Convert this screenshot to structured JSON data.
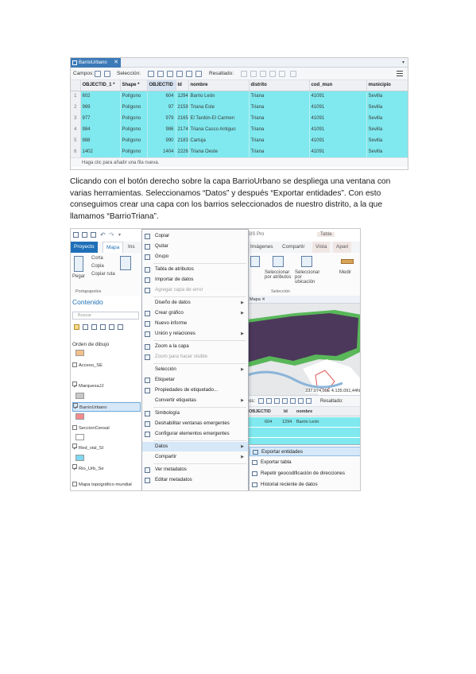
{
  "attribute_table": {
    "tab_title": "BarrioUrbano",
    "toolbar": {
      "fields_label": "Campos:",
      "selection_label": "Selección:",
      "highlight_label": "Resaltado:"
    },
    "columns": [
      "",
      "OBJECTID_1 *",
      "Shape *",
      "OBJECTID",
      "Id",
      "nombre",
      "distrito",
      "cod_mun",
      "municipio"
    ],
    "rows": [
      {
        "n": "1",
        "objectid_1": "602",
        "shape": "Polígono",
        "objectid": "604",
        "id": "1294",
        "nombre": "Barrio León",
        "distrito": "Triana",
        "cod_mun": "41091",
        "municipio": "Sevilla"
      },
      {
        "n": "2",
        "objectid_1": "969",
        "shape": "Polígono",
        "objectid": "97",
        "id": "2159",
        "nombre": "Triana Este",
        "distrito": "Triana",
        "cod_mun": "41091",
        "municipio": "Sevilla"
      },
      {
        "n": "3",
        "objectid_1": "977",
        "shape": "Polígono",
        "objectid": "979",
        "id": "2165",
        "nombre": "El Tardón-El Carmen",
        "distrito": "Triana",
        "cod_mun": "41091",
        "municipio": "Sevilla"
      },
      {
        "n": "4",
        "objectid_1": "984",
        "shape": "Polígono",
        "objectid": "986",
        "id": "2174",
        "nombre": "Triana Casco Antiguo",
        "distrito": "Triana",
        "cod_mun": "41091",
        "municipio": "Sevilla"
      },
      {
        "n": "5",
        "objectid_1": "988",
        "shape": "Polígono",
        "objectid": "990",
        "id": "2183",
        "nombre": "Cartuja",
        "distrito": "Triana",
        "cod_mun": "41091",
        "municipio": "Sevilla"
      },
      {
        "n": "6",
        "objectid_1": "1402",
        "shape": "Polígono",
        "objectid": "1404",
        "id": "2226",
        "nombre": "Triana Oeste",
        "distrito": "Triana",
        "cod_mun": "41091",
        "municipio": "Sevilla"
      }
    ],
    "status": "Haga clic para añadir una fila nueva."
  },
  "paragraph": "Clicando con el botón derecho sobre la capa BarrioUrbano se despliega una ventana con varias herramientas. Seleccionamos “Datos” y después “Exportar entidades”. Con esto conseguimos crear una capa con los barrios seleccionados de nuestro distrito, a la que llamamos “BarrioTriana”.",
  "gis": {
    "ribbon_tabs": [
      "Proyecto",
      "Mapa",
      "Ins"
    ],
    "ribbon_tabs_right": [
      "GIS Pro",
      "Tabla"
    ],
    "ribbon_subtabs": [
      "Imágenes",
      "Compartir",
      "Vista",
      "Apari"
    ],
    "clipboard": {
      "paste": "Pegar",
      "cut": "Corta",
      "copy": "Copia",
      "copy_path": "Copiar ruta",
      "group": "Portapapeles"
    },
    "ribbon_select": {
      "select_by_attr": "Seleccionar por atributos",
      "select_by_loc": "Seleccionar por ubicación",
      "group": "Selección",
      "measure": "Medir"
    },
    "content_pane": {
      "title": "Contenido",
      "search_placeholder": "Buscar",
      "draw_order": "Orden de dibujo",
      "layers": [
        "Acceso_SE",
        "MarquesaJJ",
        "BarrioUrbano",
        "SeccionCensal",
        "Red_vial_SI",
        "Rio_Urb_Se",
        "Mapa topográfico mundial"
      ]
    },
    "map_tab": "Mapa",
    "map_coords": "237.074,00E 4.135.091,44N",
    "small_table": {
      "highlight_label": "Resaltado:",
      "columns": [
        "OBJECTID",
        "Id",
        "nombre"
      ],
      "row": {
        "objectid": "604",
        "id": "1294",
        "nombre": "Barrio León"
      }
    },
    "context_menu": [
      {
        "label": "Copiar",
        "icon": "copy-icon"
      },
      {
        "label": "Quitar",
        "icon": "remove-icon"
      },
      {
        "label": "Grupo",
        "icon": "group-icon"
      },
      {
        "label": "Tabla de atributos",
        "icon": "table-icon"
      },
      {
        "label": "Importar de datos",
        "icon": "import-icon"
      },
      {
        "label": "Agregar capa de error",
        "icon": "error-layer-icon",
        "disabled": true
      },
      {
        "label": "Diseño de datos",
        "icon": "",
        "submenu": true
      },
      {
        "label": "Crear gráfico",
        "icon": "chart-icon",
        "submenu": true
      },
      {
        "label": "Nuevo informe",
        "icon": "report-icon"
      },
      {
        "label": "Unión y relaciones",
        "icon": "join-icon",
        "submenu": true
      },
      {
        "label": "Zoom a la capa",
        "icon": "zoom-layer-icon"
      },
      {
        "label": "Zoom para hacer visible",
        "icon": "zoom-visible-icon",
        "disabled": true
      },
      {
        "label": "Selección",
        "icon": "",
        "submenu": true
      },
      {
        "label": "Etiquetar",
        "icon": "label-icon"
      },
      {
        "label": "Propiedades de etiquetado...",
        "icon": "label-props-icon"
      },
      {
        "label": "Convertir etiquetas",
        "icon": "",
        "submenu": true
      },
      {
        "label": "Simbología",
        "icon": "symbology-icon"
      },
      {
        "label": "Deshabilitar ventanas emergentes",
        "icon": "popup-off-icon"
      },
      {
        "label": "Configurar elementos emergentes",
        "icon": "popup-config-icon"
      },
      {
        "label": "Datos",
        "icon": "",
        "submenu": true,
        "hover": true
      },
      {
        "label": "Compartir",
        "icon": "",
        "submenu": true
      },
      {
        "label": "Ver metadatos",
        "icon": "view-metadata-icon"
      },
      {
        "label": "Editar metadatos",
        "icon": "edit-metadata-icon"
      }
    ],
    "submenu": [
      {
        "label": "Exportar entidades",
        "hover": true
      },
      {
        "label": "Exportar tabla"
      },
      {
        "label": "Repetir geocodificación de direcciones"
      },
      {
        "label": "Historial reciente de datos"
      }
    ]
  },
  "colors": {
    "selected_row": "#7fe9ef",
    "ribbon_active": "#1e6fb8",
    "map_points": "#7a2a7a",
    "map_green": "#3fae3f",
    "hover": "#d6e8f8"
  }
}
